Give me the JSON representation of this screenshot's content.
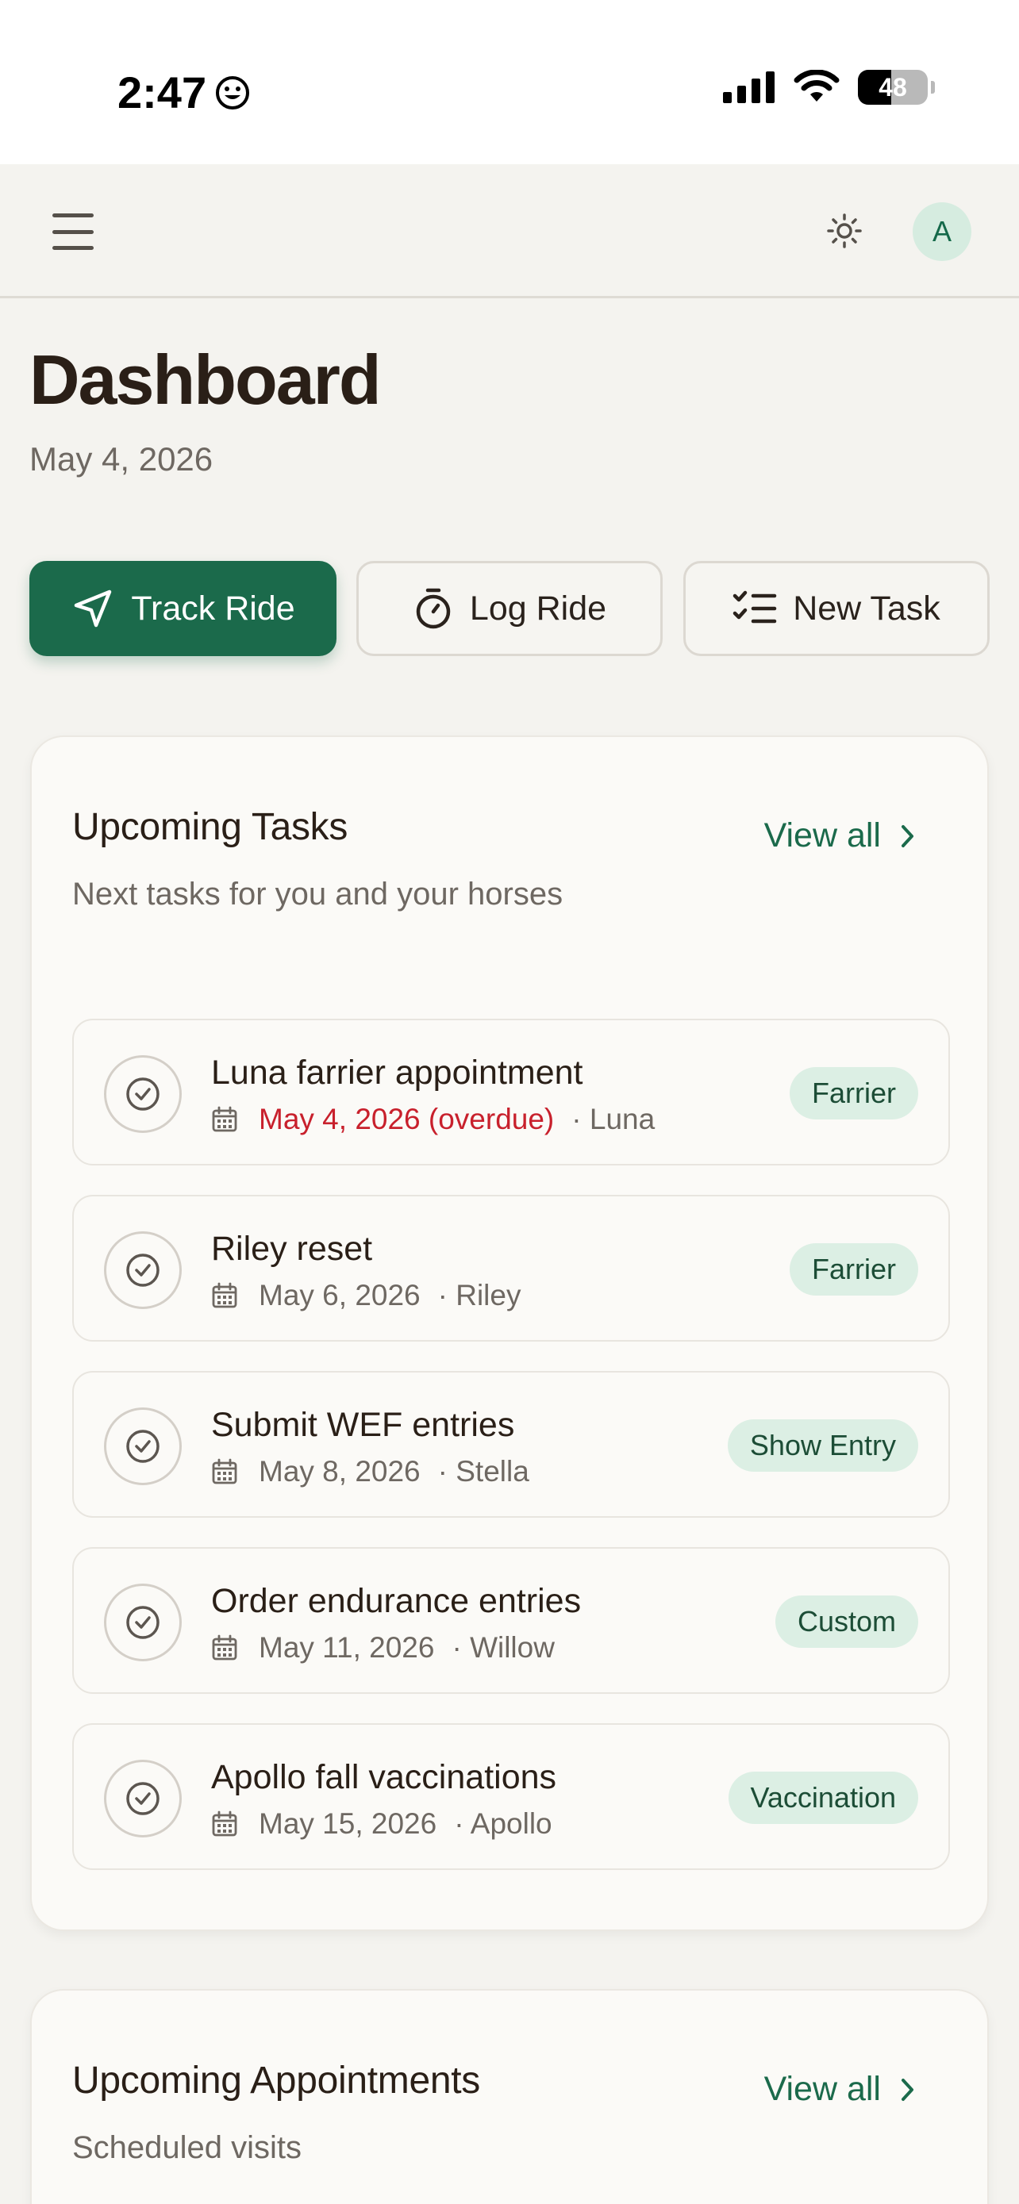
{
  "status_bar": {
    "time": "2:47",
    "battery": "48",
    "battery_level": 0.48
  },
  "header": {
    "avatar_initial": "A"
  },
  "page": {
    "title": "Dashboard",
    "date": "May 4, 2026"
  },
  "actions": {
    "track_ride": "Track Ride",
    "log_ride": "Log Ride",
    "new_task": "New Task"
  },
  "tasks_card": {
    "title": "Upcoming Tasks",
    "subtitle": "Next tasks for you and your horses",
    "view_all": "View all",
    "items": [
      {
        "name": "Luna farrier appointment",
        "date": "May 4, 2026 (overdue)",
        "horse": "· Luna",
        "badge": "Farrier",
        "overdue": true
      },
      {
        "name": "Riley reset",
        "date": "May 6, 2026",
        "horse": "· Riley",
        "badge": "Farrier",
        "overdue": false
      },
      {
        "name": "Submit WEF entries",
        "date": "May 8, 2026",
        "horse": "· Stella",
        "badge": "Show Entry",
        "overdue": false
      },
      {
        "name": "Order endurance entries",
        "date": "May 11, 2026",
        "horse": "· Willow",
        "badge": "Custom",
        "overdue": false
      },
      {
        "name": "Apollo fall vaccinations",
        "date": "May 15, 2026",
        "horse": "· Apollo",
        "badge": "Vaccination",
        "overdue": false
      }
    ]
  },
  "appointments_card": {
    "title": "Upcoming Appointments",
    "subtitle": "Scheduled visits",
    "view_all": "View all"
  },
  "colors": {
    "primary": "#1b6a4b",
    "overdue": "#c8202c",
    "badge_bg": "#dcefe4",
    "background": "#f4f3ef"
  }
}
